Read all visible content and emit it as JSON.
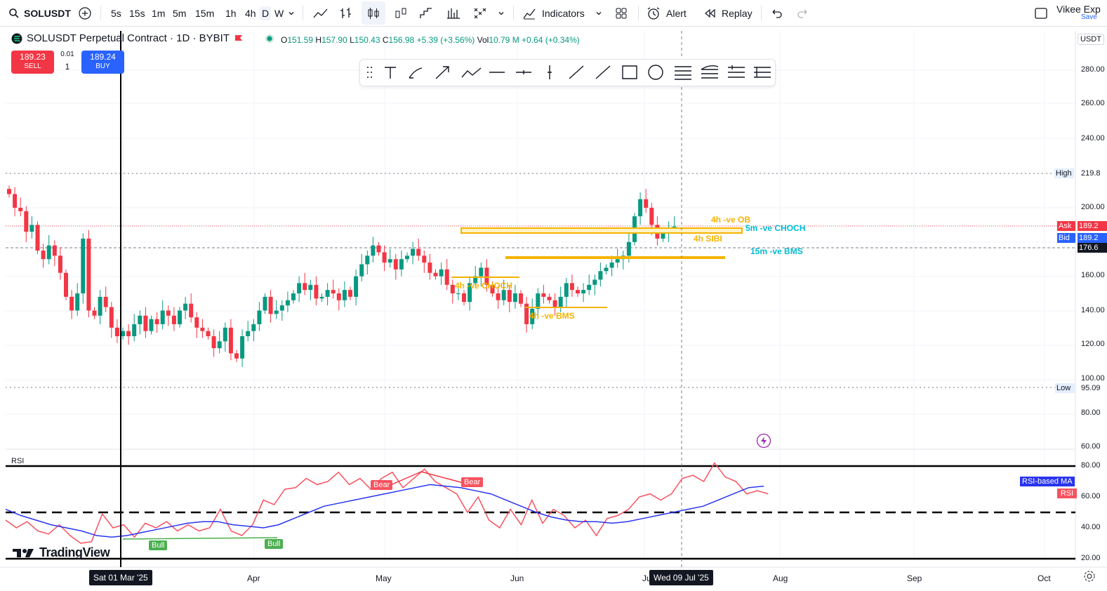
{
  "toolbar": {
    "symbol": "SOLUSDT",
    "intervals": [
      "5s",
      "15s",
      "1m",
      "5m",
      "15m",
      "1h",
      "4h",
      "D",
      "W"
    ],
    "active_interval": "D",
    "indicators_label": "Indicators",
    "alert_label": "Alert",
    "replay_label": "Replay",
    "user_name": "Vikee Exp",
    "save_label": "Save"
  },
  "legend": {
    "title": "SOLUSDT Perpetual Contract · 1D · BYBIT",
    "o_label": "O",
    "o": "151.59",
    "h_label": "H",
    "h": "157.90",
    "l_label": "L",
    "l": "150.43",
    "c_label": "C",
    "c": "156.98",
    "change": "+5.39 (+3.56%)",
    "vol_label": "Vol",
    "vol": "10.79 M",
    "vol_change": "+0.64 (+0.34%)"
  },
  "trade": {
    "sell_price": "189.23",
    "sell_label": "SELL",
    "buy_price": "189.24",
    "buy_label": "BUY",
    "spread": "0.01",
    "qty": "1"
  },
  "price_scale": {
    "currency": "USDT",
    "ticks": [
      "280.00",
      "260.00",
      "240.00",
      "220.00",
      "200.00",
      "180.00",
      "160.00",
      "140.00",
      "120.00",
      "100.00",
      "80.00",
      "60.00"
    ],
    "high_label": "High",
    "high_value": "219.8",
    "low_label": "Low",
    "low_value": "95.09",
    "ask_label": "Ask",
    "ask_value": "189.2",
    "bid_label": "Bid",
    "bid_value": "189.2",
    "last_value": "176.6"
  },
  "rsi": {
    "label": "RSI",
    "ticks": [
      "80.00",
      "60.00",
      "40.00",
      "20.00"
    ],
    "ma_label": "RSI-based MA",
    "rsi_label": "RSI",
    "bear1": "Bear",
    "bear2": "Bear",
    "bull1": "Bull",
    "bull2": "Bull"
  },
  "annotations": {
    "choch_4h": "4h -ve CHOCH",
    "bms_4h": "4h -ve BMS",
    "sibi_4h": "4h SIBI",
    "ob_4h": "4h -ve OB",
    "choch_5m": "5m -ve CHOCH",
    "bms_15m": "15m -ve BMS"
  },
  "time_axis": {
    "labels": [
      "Apr",
      "May",
      "Jun",
      "Ju",
      "Aug",
      "Sep",
      "Oct"
    ],
    "cursor_left": "Sat 01 Mar '25",
    "cursor_right": "Wed 09 Jul '25"
  },
  "brand": "TradingView",
  "colors": {
    "up": "#089981",
    "down": "#f23645",
    "zone": "#f5b301",
    "rsi": "#f7525f",
    "rsi_ma": "#2934ef",
    "accent": "#2962ff"
  },
  "chart_data": {
    "type": "candlestick",
    "price_range": [
      60,
      290
    ],
    "candles_close": [
      208,
      200,
      198,
      186,
      190,
      175,
      170,
      178,
      172,
      162,
      148,
      140,
      150,
      182,
      140,
      137,
      148,
      142,
      130,
      125,
      128,
      125,
      132,
      137,
      128,
      135,
      132,
      140,
      137,
      132,
      140,
      144,
      136,
      130,
      128,
      125,
      118,
      122,
      130,
      115,
      112,
      125,
      128,
      132,
      140,
      148,
      138,
      140,
      143,
      146,
      150,
      156,
      152,
      155,
      147,
      148,
      152,
      150,
      146,
      152,
      148,
      160,
      167,
      172,
      178,
      174,
      168,
      170,
      164,
      170,
      172,
      176,
      172,
      168,
      162,
      160,
      164,
      155,
      150,
      150,
      145,
      156,
      160,
      165,
      155,
      150,
      146,
      152,
      145,
      150,
      144,
      132,
      141,
      150,
      148,
      146,
      142,
      148,
      156,
      152,
      150,
      152,
      155,
      158,
      163,
      165,
      168,
      170,
      172,
      180,
      195,
      205,
      200,
      190,
      182,
      185,
      188,
      189
    ]
  }
}
